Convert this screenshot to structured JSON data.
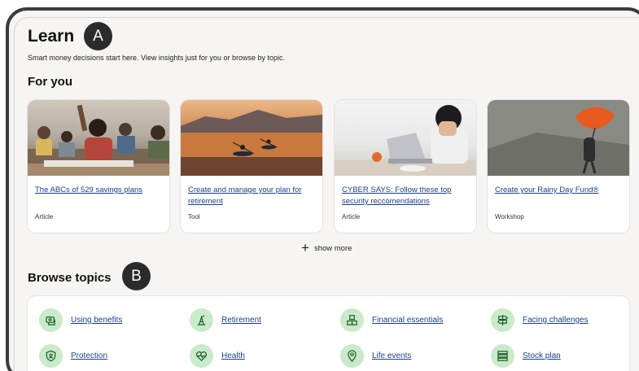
{
  "header": {
    "title": "Learn",
    "subtitle": "Smart money decisions start here. View insights just for you or browse by topic.",
    "badge_a": "A",
    "badge_b": "B"
  },
  "for_you": {
    "heading": "For you",
    "cards": [
      {
        "title": "The ABCs of 529 savings plans",
        "type": "Article"
      },
      {
        "title": "Create and manage your plan for retirement",
        "type": "Tool"
      },
      {
        "title": "CYBER SAYS: Follow these top security reccomendations",
        "type": "Article"
      },
      {
        "title": "Create your Rainy Day Fund®",
        "type": "Workshop"
      }
    ],
    "show_more": "show more"
  },
  "browse": {
    "heading": "Browse topics",
    "topics": [
      {
        "label": "Using benefits",
        "icon": "benefits-icon"
      },
      {
        "label": "Retirement",
        "icon": "retirement-icon"
      },
      {
        "label": "Financial essentials",
        "icon": "blocks-icon"
      },
      {
        "label": "Facing challenges",
        "icon": "signpost-icon"
      },
      {
        "label": "Protection",
        "icon": "shield-icon"
      },
      {
        "label": "Health",
        "icon": "heart-icon"
      },
      {
        "label": "Life events",
        "icon": "location-pin-icon"
      },
      {
        "label": "Stock plan",
        "icon": "stock-list-icon"
      }
    ]
  },
  "colors": {
    "link": "#1b3f8b",
    "icon_bg": "#c9ebc9",
    "icon_stroke": "#1f5a2a"
  }
}
